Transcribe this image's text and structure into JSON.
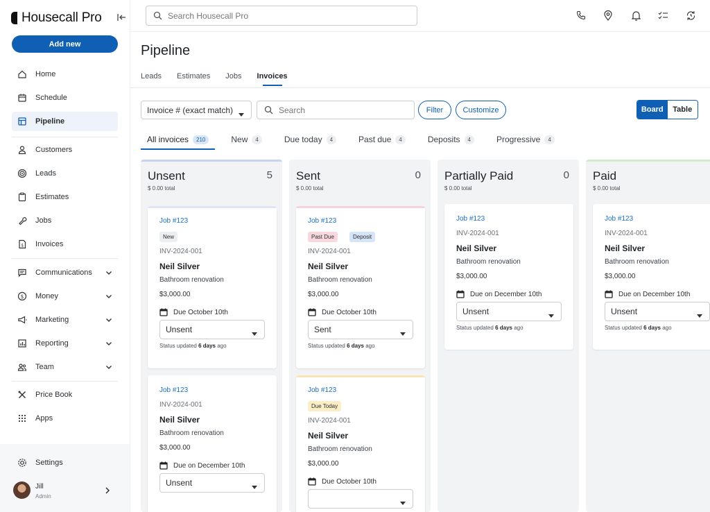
{
  "app": {
    "logo_text": "Housecall Pro",
    "add_new_label": "Add new"
  },
  "sidebar": {
    "items": [
      {
        "label": "Home",
        "icon": "home-icon"
      },
      {
        "label": "Schedule",
        "icon": "calendar-icon"
      },
      {
        "label": "Pipeline",
        "icon": "pipeline-icon",
        "active": true
      },
      {
        "label": "Customers",
        "icon": "person-icon"
      },
      {
        "label": "Leads",
        "icon": "target-icon"
      },
      {
        "label": "Estimates",
        "icon": "clipboard-icon"
      },
      {
        "label": "Jobs",
        "icon": "wrench-icon"
      },
      {
        "label": "Invoices",
        "icon": "invoice-icon"
      },
      {
        "label": "Communications",
        "icon": "chat-icon"
      },
      {
        "label": "Money",
        "icon": "dollar-icon"
      },
      {
        "label": "Marketing",
        "icon": "megaphone-icon"
      },
      {
        "label": "Reporting",
        "icon": "chart-icon"
      },
      {
        "label": "Team",
        "icon": "team-icon"
      },
      {
        "label": "Price Book",
        "icon": "tools-icon"
      },
      {
        "label": "Apps",
        "icon": "grid-icon"
      }
    ],
    "settings_label": "Settings",
    "user": {
      "name": "Jill",
      "role": "Admin"
    }
  },
  "topbar": {
    "search_placeholder": "Search Housecall Pro"
  },
  "main": {
    "title": "Pipeline",
    "tabs": [
      "Leads",
      "Estimates",
      "Jobs",
      "Invoices"
    ],
    "active_tab": "Invoices",
    "filter_select": "Invoice # (exact match)",
    "search_placeholder": "Search",
    "filter_label": "Filter",
    "customize_label": "Customize",
    "view_toggle": {
      "board": "Board",
      "table": "Table",
      "selected": "Board"
    },
    "subtabs": [
      {
        "label": "All invoices",
        "count": "210"
      },
      {
        "label": "New",
        "count": "4"
      },
      {
        "label": "Due today",
        "count": "4"
      },
      {
        "label": "Past due",
        "count": "4"
      },
      {
        "label": "Deposits",
        "count": "4"
      },
      {
        "label": "Progressive",
        "count": "4"
      }
    ]
  },
  "board": {
    "columns": [
      {
        "title": "Unsent",
        "count": "5",
        "total": "$ 0.00 total",
        "accent": "#c7d3ef",
        "cards": [
          {
            "job": "Job #123",
            "badges": [
              {
                "text": "New",
                "bg": "#eceef0"
              }
            ],
            "invoice": "INV-2024-001",
            "customer": "Neil Silver",
            "description": "Bathroom renovation",
            "amount": "$3,000.00",
            "due": "Due October 10th",
            "status": "Unsent",
            "updated_prefix": "Status updated",
            "updated_value": "6 days",
            "updated_suffix": "ago",
            "accent": "#dfe5f5"
          },
          {
            "job": "Job #123",
            "badges": [],
            "invoice": "INV-2024-001",
            "customer": "Neil Silver",
            "description": "Bathroom renovation",
            "amount": "$3,000.00",
            "due": "Due on December 10th",
            "status": "Unsent",
            "accent": ""
          }
        ]
      },
      {
        "title": "Sent",
        "count": "0",
        "total": "$ 0.00 total",
        "accent": "",
        "cards": [
          {
            "job": "Job #123",
            "badges": [
              {
                "text": "Past Due",
                "bg": "#f8d8dc"
              },
              {
                "text": "Deposit",
                "bg": "#d5e4f7"
              }
            ],
            "invoice": "INV-2024-001",
            "customer": "Neil Silver",
            "description": "Bathroom renovation",
            "amount": "$3,000.00",
            "due": "Due October 10th",
            "status": "Sent",
            "updated_prefix": "Status updated",
            "updated_value": "6 days",
            "updated_suffix": "ago",
            "accent": "#f6d3d8"
          },
          {
            "job": "Job #123",
            "badges": [
              {
                "text": "Due Today",
                "bg": "#fbeec4"
              }
            ],
            "invoice": "INV-2024-001",
            "customer": "Neil Silver",
            "description": "Bathroom renovation",
            "amount": "$3,000.00",
            "due": "Due October 10th",
            "status": "",
            "accent": "#f8e7b5"
          }
        ]
      },
      {
        "title": "Partially Paid",
        "count": "0",
        "total": "$ 0.00 total",
        "accent": "",
        "cards": [
          {
            "job": "Job #123",
            "badges": [],
            "invoice": "INV-2024-001",
            "customer": "Neil Silver",
            "description": "Bathroom renovation",
            "amount": "$3,000.00",
            "due": "Due on December 10th",
            "status": "Unsent",
            "updated_prefix": "Status updated",
            "updated_value": "6 days",
            "updated_suffix": "ago",
            "accent": ""
          }
        ]
      },
      {
        "title": "Paid",
        "count": "",
        "total": "$ 0.00 total",
        "accent": "#cfeccf",
        "cards": [
          {
            "job": "Job #123",
            "badges": [],
            "invoice": "INV-2024-001",
            "customer": "Neil Silver",
            "description": "Bathroom renovation",
            "amount": "$3,000.00",
            "due": "Due on December 10th",
            "status": "Unsent",
            "updated_prefix": "Status updated",
            "updated_value": "6 days",
            "updated_suffix": "ago",
            "accent": ""
          }
        ]
      }
    ]
  },
  "colors": {
    "primary": "#0f5fb5",
    "link": "#1a6fc4",
    "column_bg": "#f2f3f5"
  }
}
